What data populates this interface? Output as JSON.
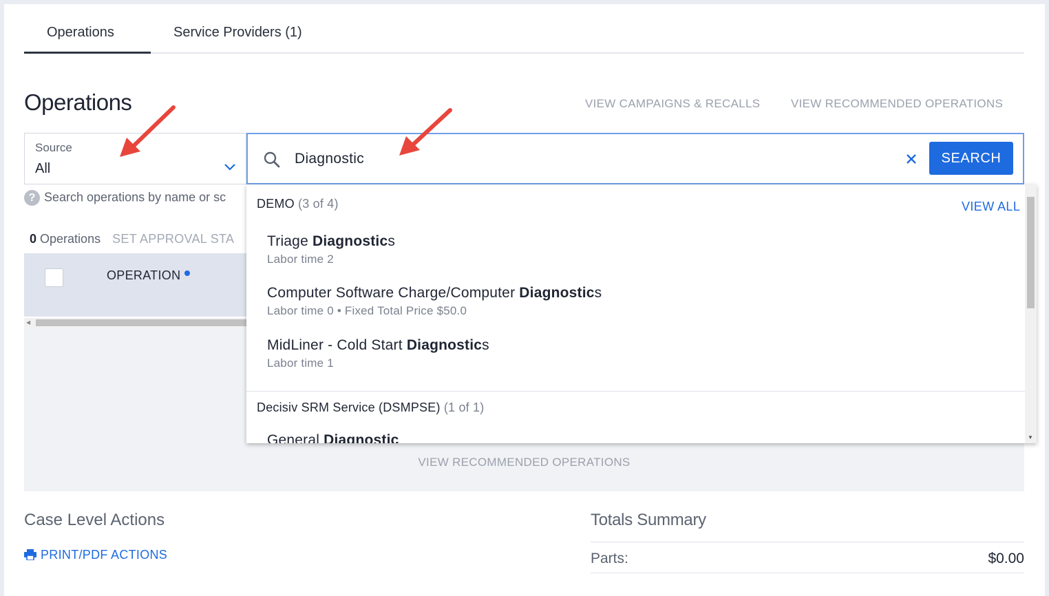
{
  "tabs": [
    {
      "label": "Operations",
      "active": true
    },
    {
      "label": "Service Providers (1)",
      "active": false
    }
  ],
  "page": {
    "title": "Operations",
    "links": {
      "campaigns": "VIEW CAMPAIGNS & RECALLS",
      "recommended": "VIEW RECOMMENDED OPERATIONS"
    }
  },
  "source": {
    "label": "Source",
    "value": "All"
  },
  "hint": "Search operations by name or sc",
  "operations": {
    "count": "0",
    "count_label": "Operations",
    "set_approval": "SET APPROVAL STA",
    "column_operation": "OPERATION",
    "empty_link": "VIEW RECOMMENDED OPERATIONS"
  },
  "search": {
    "value": "Diagnostic",
    "button_label": "SEARCH"
  },
  "results": {
    "view_all": "VIEW ALL",
    "groups": [
      {
        "name": "DEMO",
        "count": "(3 of 4)",
        "items": [
          {
            "prefix": "Triage ",
            "match": "Diagnostic",
            "suffix": "s",
            "sub": "Labor time 2"
          },
          {
            "prefix": "Computer Software Charge/Computer ",
            "match": "Diagnostic",
            "suffix": "s",
            "sub": "Labor time 0 • Fixed Total Price $50.0"
          },
          {
            "prefix": "MidLiner - Cold Start ",
            "match": "Diagnostic",
            "suffix": "s",
            "sub": "Labor time 1"
          }
        ]
      },
      {
        "name": "Decisiv SRM Service (DSMPSE)",
        "count": "(1 of 1)",
        "items": [
          {
            "prefix": "General ",
            "match": "Diagnostic",
            "suffix": "",
            "sub": ""
          }
        ]
      }
    ]
  },
  "case_actions": {
    "title": "Case Level Actions",
    "print_label": "PRINT/PDF ACTIONS"
  },
  "totals": {
    "title": "Totals Summary",
    "parts_label": "Parts:",
    "parts_value": "$0.00"
  },
  "colors": {
    "accent": "#1e6be0",
    "annotation_arrow": "#e8463c"
  },
  "icons": {
    "search": "search-icon",
    "clear": "close-icon",
    "chevron": "chevron-down-icon",
    "help": "question-circle-icon",
    "print": "printer-icon"
  }
}
